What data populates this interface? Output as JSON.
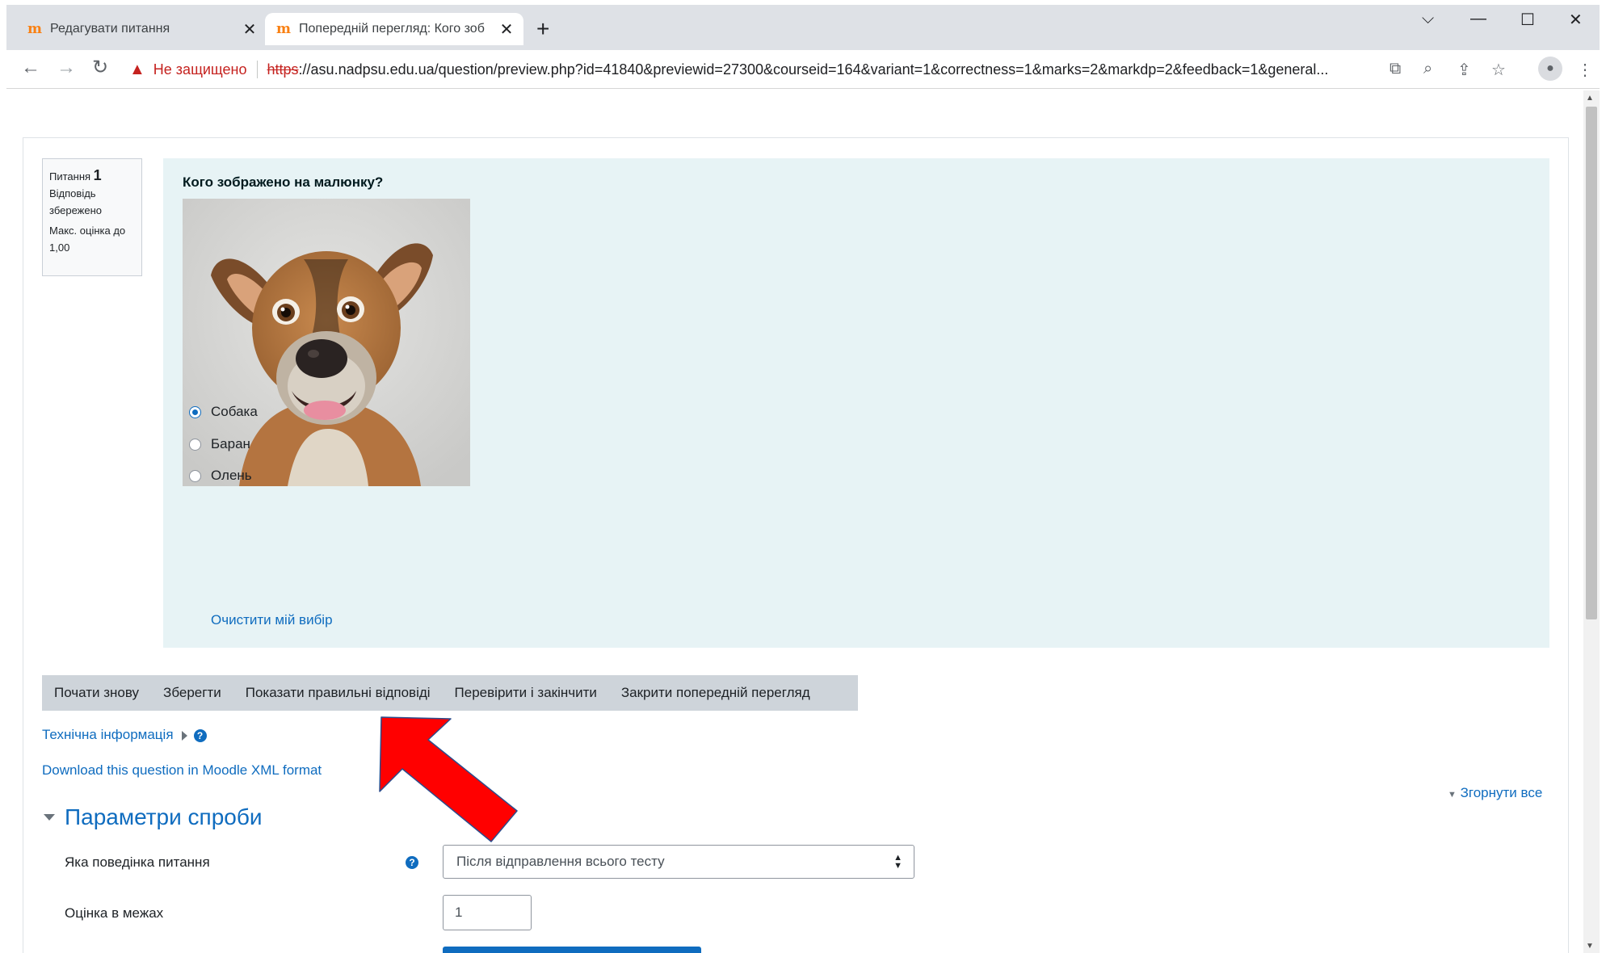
{
  "browser": {
    "tabs": [
      {
        "label": "Редагувати питання",
        "active": false
      },
      {
        "label": "Попередній перегляд: Кого зоб",
        "active": true
      }
    ],
    "security_warning": "Не защищено",
    "url_scheme": "https",
    "url_rest": "://asu.nadpsu.edu.ua/question/preview.php?id=41840&previewid=27300&courseid=164&variant=1&correctness=1&marks=2&markdp=2&feedback=1&general..."
  },
  "question_info": {
    "label": "Питання",
    "number": "1",
    "state": "Відповідь збережено",
    "max_mark": "Макс. оцінка до 1,00"
  },
  "question": {
    "text": "Кого зображено на малюнку?",
    "answers": [
      {
        "label": "Собака",
        "checked": true
      },
      {
        "label": "Баран",
        "checked": false
      },
      {
        "label": "Олень",
        "checked": false
      }
    ],
    "clear_choice": "Очистити мій вибір"
  },
  "actions": [
    "Почати знову",
    "Зберегти",
    "Показати правильні відповіді",
    "Перевірити і закінчити",
    "Закрити попередній перегляд"
  ],
  "links": {
    "tech_info": "Технічна інформація",
    "download_xml": "Download this question in Moodle XML format",
    "collapse_all": "Згорнути все"
  },
  "attempt_options": {
    "title": "Параметри спроби",
    "behaviour_label": "Яка поведінка питання",
    "behaviour_value": "Після відправлення всього тесту",
    "marked_out_of_label": "Оцінка в межах",
    "marked_out_of_value": "1"
  },
  "colors": {
    "accent": "#0f6cbf",
    "formulation_bg": "#e7f3f5",
    "annotation_arrow": "#ff0000"
  }
}
